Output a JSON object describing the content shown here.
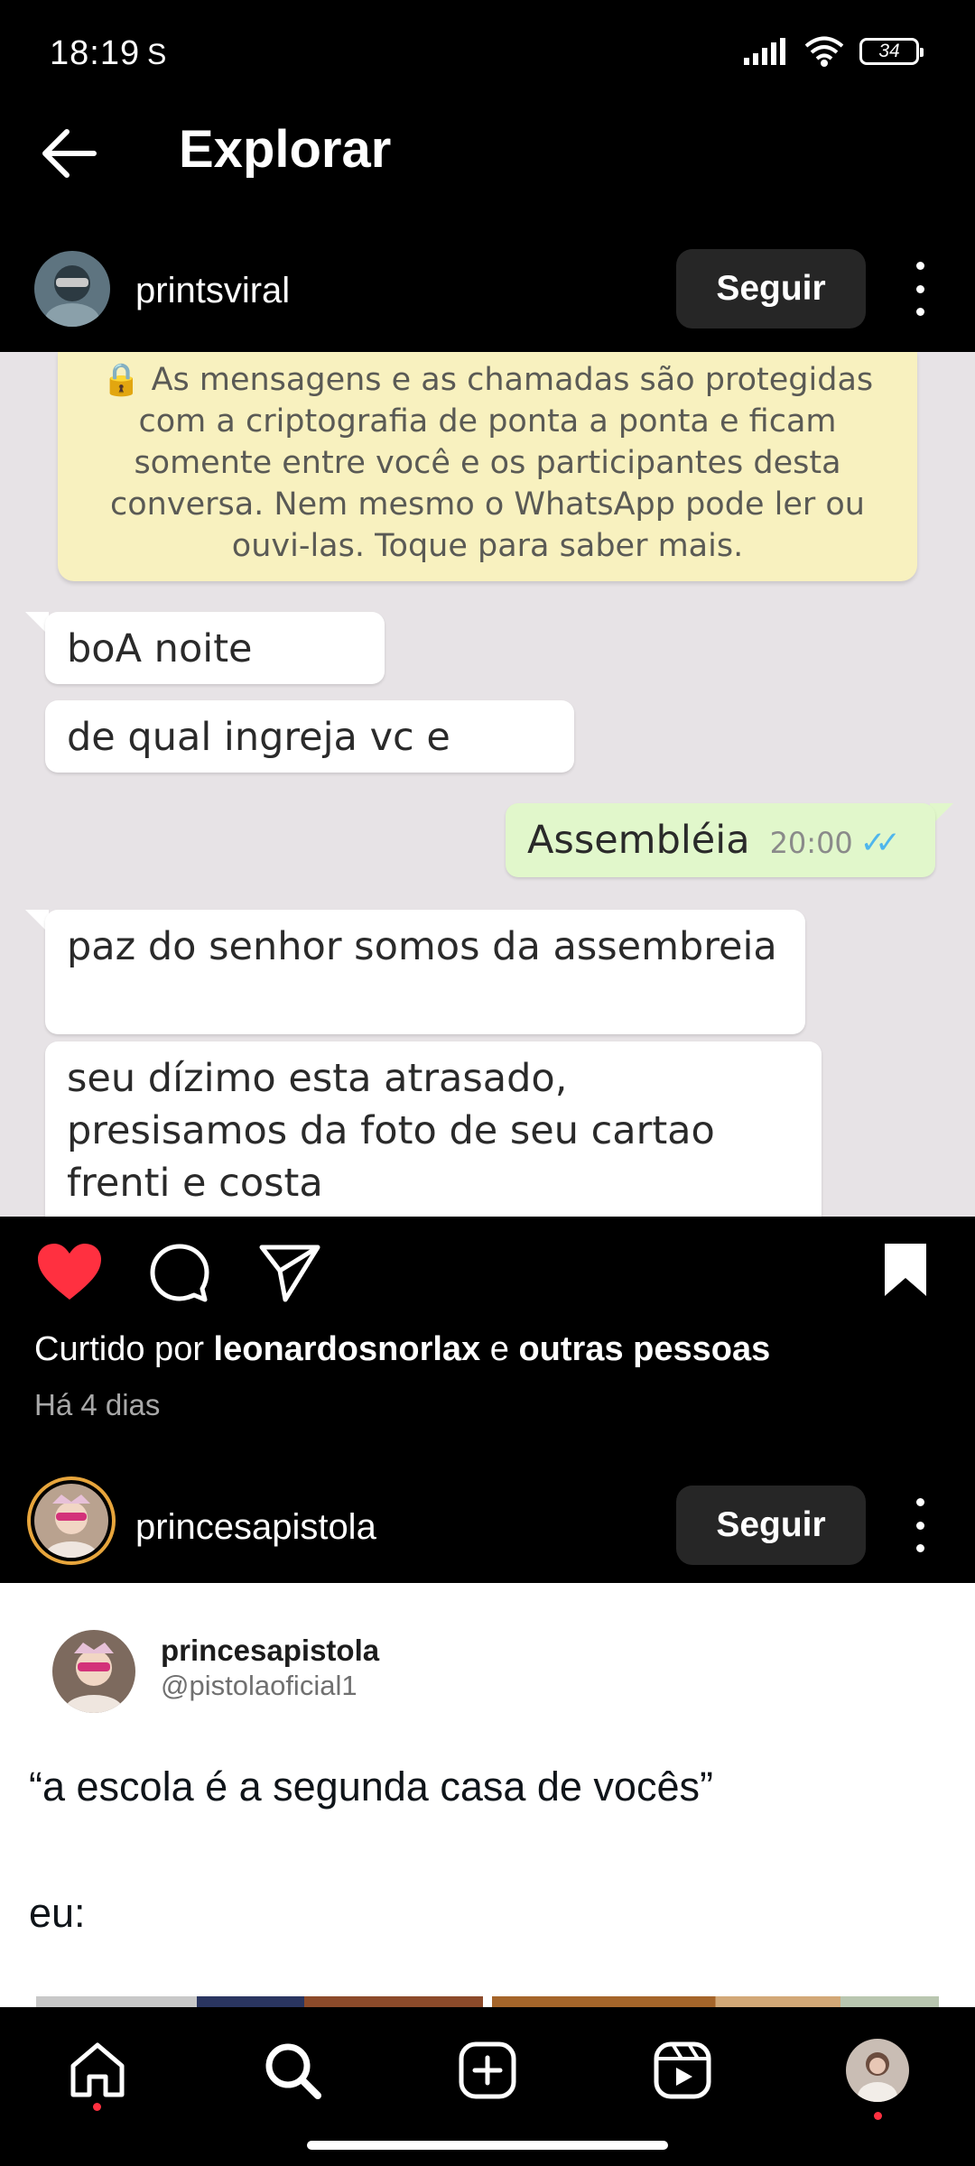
{
  "status_bar": {
    "time": "18:19",
    "carrier_indicator": "S",
    "battery": "34"
  },
  "header": {
    "title": "Explorar"
  },
  "post1": {
    "username": "printsviral",
    "follow_label": "Seguir",
    "image": {
      "encryption_notice": [
        "🔒 As mensagens e as chamadas são protegidas",
        "com a criptografia de ponta a ponta e ficam",
        "somente entre você e os participantes desta",
        "conversa. Nem mesmo o WhatsApp pode ler ou",
        "ouvi-las. Toque para saber mais."
      ],
      "messages": [
        {
          "direction": "in",
          "text": "boA noite"
        },
        {
          "direction": "in",
          "text": "de qual ingreja vc e"
        },
        {
          "direction": "out",
          "text": "Assembléia",
          "time": "20:00"
        },
        {
          "direction": "in",
          "text": "paz do senhor somos da assembreia"
        },
        {
          "direction": "in",
          "lines": [
            "seu dízimo esta atrasado,",
            "presisamos da foto de seu cartao",
            "frenti e costa"
          ]
        }
      ]
    },
    "liked": true,
    "saved": true,
    "likes_prefix": "Curtido por ",
    "likes_user": "leonardosnorlax",
    "likes_conj": " e ",
    "likes_others": "outras pessoas",
    "time_ago": "Há 4 dias"
  },
  "post2": {
    "username": "princesapistola",
    "follow_label": "Seguir",
    "tweet": {
      "name": "princesapistola",
      "handle": "@pistolaoficial1",
      "line1": "“a escola é a segunda casa de vocês”",
      "line2": "eu:"
    }
  },
  "nav": {
    "items": [
      "home-icon",
      "search-icon",
      "create-icon",
      "reels-icon",
      "profile-avatar"
    ],
    "colors": {
      "notification": "#ff3040",
      "like": "#ff3040"
    }
  }
}
